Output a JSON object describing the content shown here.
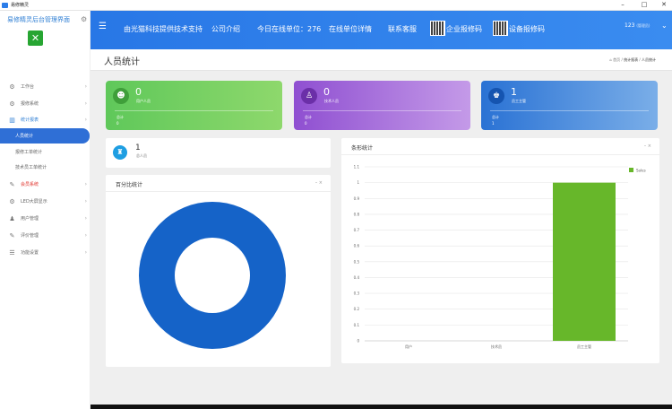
{
  "window": {
    "title": "易修精灵",
    "minimize": "–",
    "maximize": "□",
    "close": "✕"
  },
  "sidebar": {
    "brand": "易修精灵后台管理界面",
    "items": [
      {
        "label": "工作台",
        "icon": "gears-icon"
      },
      {
        "label": "报修系统",
        "icon": "gears-icon"
      },
      {
        "label": "统计报表",
        "icon": "bar-chart-icon"
      },
      {
        "label": "人员统计",
        "icon": ""
      },
      {
        "label": "报修工单统计",
        "icon": ""
      },
      {
        "label": "技术员工单统计",
        "icon": ""
      },
      {
        "label": "会员系统",
        "icon": "edit-icon"
      },
      {
        "label": "LED大屏显示",
        "icon": "gears-icon"
      },
      {
        "label": "用户管理",
        "icon": "users-icon"
      },
      {
        "label": "评价管理",
        "icon": "edit-icon"
      },
      {
        "label": "功能设置",
        "icon": "sliders-icon"
      }
    ]
  },
  "header": {
    "support": "由光猫科技提供技术支持",
    "about": "公司介绍",
    "online": "今日在线单位：276",
    "online_detail": "在线单位详情",
    "service": "联系客服",
    "qr1": "企业报修码",
    "qr2": "设备报修码",
    "user": "123",
    "user_role": "(管理员)"
  },
  "page": {
    "title": "人员统计",
    "crumb_home": "⌂ 首页",
    "crumb_sep": "/",
    "crumb_1": "统计报表",
    "crumb_2": "人员统计"
  },
  "stats": [
    {
      "num": "0",
      "label": "用户人员",
      "sub1": "总计",
      "sub2": "0",
      "color": "#5cc45a"
    },
    {
      "num": "0",
      "label": "技术人员",
      "sub1": "总计",
      "sub2": "0",
      "color": "#9a5ad6"
    },
    {
      "num": "1",
      "label": "员工主管",
      "sub1": "总计",
      "sub2": "1",
      "color": "#2c7bd9"
    }
  ],
  "mini": {
    "num": "1",
    "label": "总人员"
  },
  "pie_card": {
    "title": "百分比统计",
    "controls": "–  ×"
  },
  "bar_card": {
    "title": "条形统计",
    "controls": "–  ×"
  },
  "chart_data": [
    {
      "type": "bar",
      "title": "条形统计",
      "categories": [
        "用户",
        "技术员",
        "员工主管"
      ],
      "series": [
        {
          "name": "Sales",
          "values": [
            0,
            0,
            1
          ]
        }
      ],
      "ylim": [
        0,
        1.1
      ],
      "yticks": [
        "0",
        "0.1",
        "0.2",
        "0.3",
        "0.4",
        "0.5",
        "0.6",
        "0.7",
        "0.8",
        "0.9",
        "1",
        "1.1"
      ],
      "legend": "top-right",
      "color": "#67b72a"
    },
    {
      "type": "pie",
      "title": "百分比统计",
      "slices": [
        {
          "value": 1
        }
      ],
      "color": "#1563c8",
      "donut": true
    }
  ]
}
